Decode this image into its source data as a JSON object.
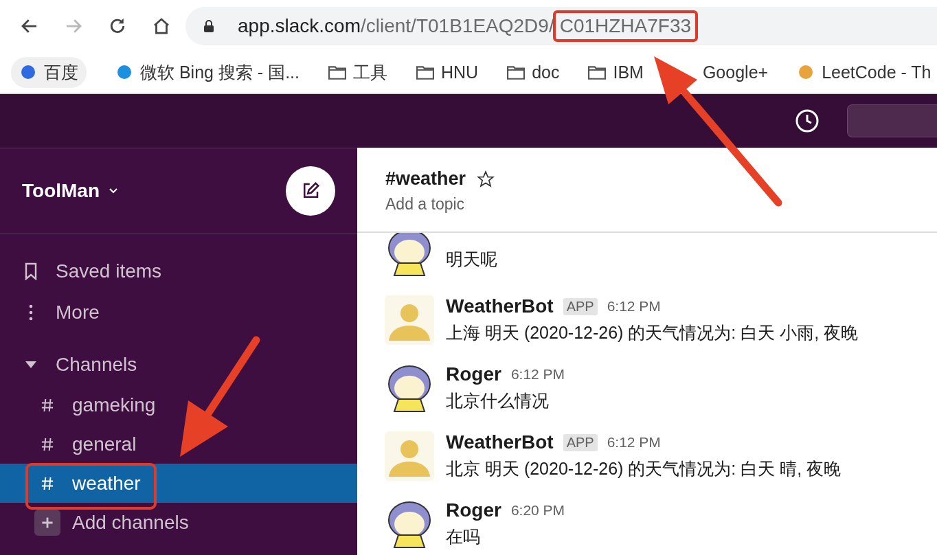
{
  "browser": {
    "nav": [
      {
        "kind": "back",
        "disabled": false
      },
      {
        "kind": "forward",
        "disabled": true
      },
      {
        "kind": "reload",
        "disabled": false
      },
      {
        "kind": "home",
        "disabled": false
      }
    ],
    "url": {
      "host": "app.slack.com",
      "path": "/client/T01B1EAQ2D9/",
      "channel_id": "C01HZHA7F33"
    },
    "bookmarks": [
      {
        "label": "百度",
        "kind": "site"
      },
      {
        "label": "微软 Bing 搜索 - 国...",
        "kind": "site"
      },
      {
        "label": "工具",
        "kind": "folder"
      },
      {
        "label": "HNU",
        "kind": "folder"
      },
      {
        "label": "doc",
        "kind": "folder"
      },
      {
        "label": "IBM",
        "kind": "folder"
      },
      {
        "label": "Google+",
        "kind": "hidden-icon"
      },
      {
        "label": "LeetCode - Th",
        "kind": "site"
      }
    ]
  },
  "workspace": {
    "name": "ToolMan"
  },
  "sidebar": {
    "items": [
      {
        "label": "Saved items",
        "kind": "saved"
      },
      {
        "label": "More",
        "kind": "more"
      }
    ],
    "section": {
      "label": "Channels",
      "expanded": true
    },
    "channels": [
      {
        "name": "gameking",
        "selected": false
      },
      {
        "name": "general",
        "selected": false
      },
      {
        "name": "weather",
        "selected": true
      }
    ],
    "add": "Add channels"
  },
  "channel": {
    "name": "#weather",
    "starred": false,
    "topic": "Add a topic"
  },
  "messages": [
    {
      "kind": "user",
      "text": "明天呢"
    },
    {
      "kind": "bot",
      "author": "WeatherBot",
      "badge": "APP",
      "time": "6:12 PM",
      "text": "上海 明天 (2020-12-26) 的天气情况为: 白天 小雨, 夜晚"
    },
    {
      "kind": "user",
      "author": "Roger",
      "time": "6:12 PM",
      "text": "北京什么情况"
    },
    {
      "kind": "bot",
      "author": "WeatherBot",
      "badge": "APP",
      "time": "6:12 PM",
      "text": "北京 明天 (2020-12-26) 的天气情况为: 白天 晴, 夜晚"
    },
    {
      "kind": "user",
      "author": "Roger",
      "time": "6:20 PM",
      "text": "在吗"
    }
  ]
}
